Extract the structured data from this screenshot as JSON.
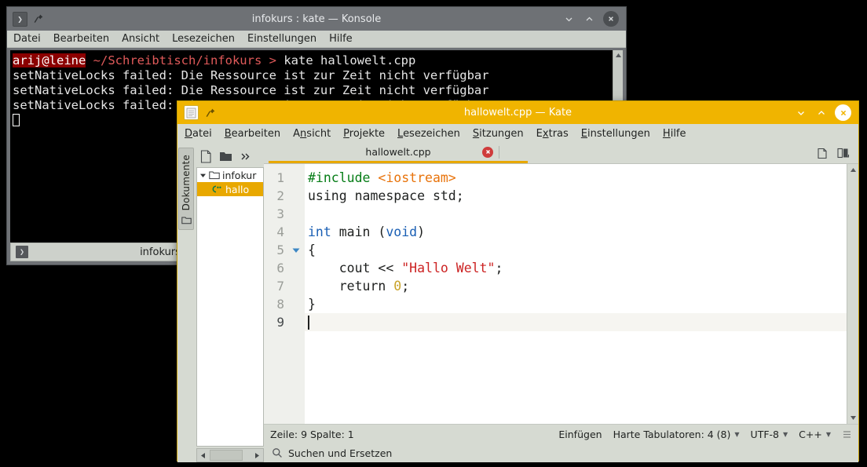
{
  "konsole": {
    "title": "infokurs : kate — Konsole",
    "app_icon": "terminal-icon",
    "pin_icon": "pin-icon",
    "controls": {
      "minimize": "minimize-icon",
      "maximize": "maximize-icon",
      "close": "close-icon"
    },
    "menu": [
      "Datei",
      "Bearbeiten",
      "Ansicht",
      "Lesezeichen",
      "Einstellungen",
      "Hilfe"
    ],
    "terminal": {
      "prompt_user": "arij@leine",
      "prompt_path": "~/Schreibtisch/infokurs",
      "prompt_arrow": ">",
      "command": "kate hallowelt.cpp",
      "output_lines": [
        "setNativeLocks failed: Die Ressource ist zur Zeit nicht verfügbar",
        "setNativeLocks failed: Die Ressource ist zur Zeit nicht verfügbar",
        "setNativeLocks failed: Die Ressource ist zur Zeit nicht verfügbar"
      ],
      "cursor": "block-cursor"
    },
    "tab_label": "infokurs",
    "tab_icon": "terminal-icon"
  },
  "kate": {
    "title": "hallowelt.cpp  — Kate",
    "app_icon": "document-icon",
    "pin_icon": "pin-icon",
    "controls": {
      "minimize": "minimize-icon",
      "maximize": "maximize-icon",
      "close": "close-icon"
    },
    "menu": [
      {
        "pre": "",
        "mnemonic": "D",
        "post": "atei"
      },
      {
        "pre": "",
        "mnemonic": "B",
        "post": "earbeiten"
      },
      {
        "pre": "A",
        "mnemonic": "n",
        "post": "sicht"
      },
      {
        "pre": "",
        "mnemonic": "P",
        "post": "rojekte"
      },
      {
        "pre": "",
        "mnemonic": "L",
        "post": "esezeichen"
      },
      {
        "pre": "",
        "mnemonic": "S",
        "post": "itzungen"
      },
      {
        "pre": "E",
        "mnemonic": "x",
        "post": "tras"
      },
      {
        "pre": "",
        "mnemonic": "E",
        "post": "instellungen"
      },
      {
        "pre": "",
        "mnemonic": "H",
        "post": "ilfe"
      }
    ],
    "sidebar": {
      "vertical_tab_label": "Dokumente",
      "vertical_tab_icon": "folder-icon"
    },
    "doc_toolbar": {
      "new_icon": "new-document-icon",
      "open_icon": "open-folder-icon",
      "more_icon": "chevron-more-icon"
    },
    "doc_tree": {
      "folder_label": "infokur",
      "folder_icon": "folder-icon",
      "expand_icon": "triangle-down-icon",
      "file_label": "hallo",
      "file_icon": "cpp-file-icon"
    },
    "doc_hscroll": {
      "left_icon": "arrow-left-icon",
      "right_icon": "arrow-right-icon"
    },
    "tab": {
      "label": "hallowelt.cpp",
      "close_icon": "close-tab-icon",
      "accent_color": "#e8a800"
    },
    "tabrow_right": {
      "documents_icon": "document-list-icon",
      "split_icon": "split-view-icon"
    },
    "editor": {
      "line_numbers": [
        "1",
        "2",
        "3",
        "4",
        "5",
        "6",
        "7",
        "8",
        "9"
      ],
      "fold_marker_line": 5,
      "fold_icon": "triangle-down-icon",
      "current_line": 9,
      "lines": [
        {
          "n": 1,
          "tokens": [
            {
              "t": "#include ",
              "c": "tok-pre"
            },
            {
              "t": "<iostream>",
              "c": "tok-inc"
            }
          ]
        },
        {
          "n": 2,
          "tokens": [
            {
              "t": "using namespace std;",
              "c": "tok-plain"
            }
          ]
        },
        {
          "n": 3,
          "tokens": []
        },
        {
          "n": 4,
          "tokens": [
            {
              "t": "int",
              "c": "tok-kw"
            },
            {
              "t": " main (",
              "c": "tok-plain"
            },
            {
              "t": "void",
              "c": "tok-kw"
            },
            {
              "t": ")",
              "c": "tok-plain"
            }
          ]
        },
        {
          "n": 5,
          "tokens": [
            {
              "t": "{",
              "c": "tok-plain"
            }
          ]
        },
        {
          "n": 6,
          "tokens": [
            {
              "t": "    cout << ",
              "c": "tok-plain"
            },
            {
              "t": "\"Hallo Welt\"",
              "c": "tok-str"
            },
            {
              "t": ";",
              "c": "tok-plain"
            }
          ]
        },
        {
          "n": 7,
          "tokens": [
            {
              "t": "    return ",
              "c": "tok-plain"
            },
            {
              "t": "0",
              "c": "tok-num"
            },
            {
              "t": ";",
              "c": "tok-plain"
            }
          ]
        },
        {
          "n": 8,
          "tokens": [
            {
              "t": "}",
              "c": "tok-plain"
            }
          ]
        },
        {
          "n": 9,
          "tokens": [],
          "caret": true
        }
      ],
      "scrollbar": {
        "up_icon": "arrow-up-icon",
        "down_icon": "arrow-down-icon"
      }
    },
    "statusbar": {
      "position": "Zeile: 9 Spalte: 1",
      "insert_mode": "Einfügen",
      "tabs": "Harte Tabulatoren: 4 (8)",
      "encoding": "UTF-8",
      "language": "C++",
      "menu_icon": "hamburger-icon",
      "dropdown_icon": "caret-down-icon"
    },
    "searchbar": {
      "label": "Suchen und Ersetzen",
      "icon": "search-icon"
    }
  },
  "colors": {
    "kate_accent": "#f0b400",
    "tab_accent": "#e8a800",
    "prompt_user_bg": "#8b0000",
    "prompt_path": "#e05a5a",
    "syntax_preprocessor": "#067d17",
    "syntax_include": "#e8730b",
    "syntax_keyword": "#1a5fb4",
    "syntax_string": "#cc2222",
    "syntax_number": "#c9a227"
  }
}
